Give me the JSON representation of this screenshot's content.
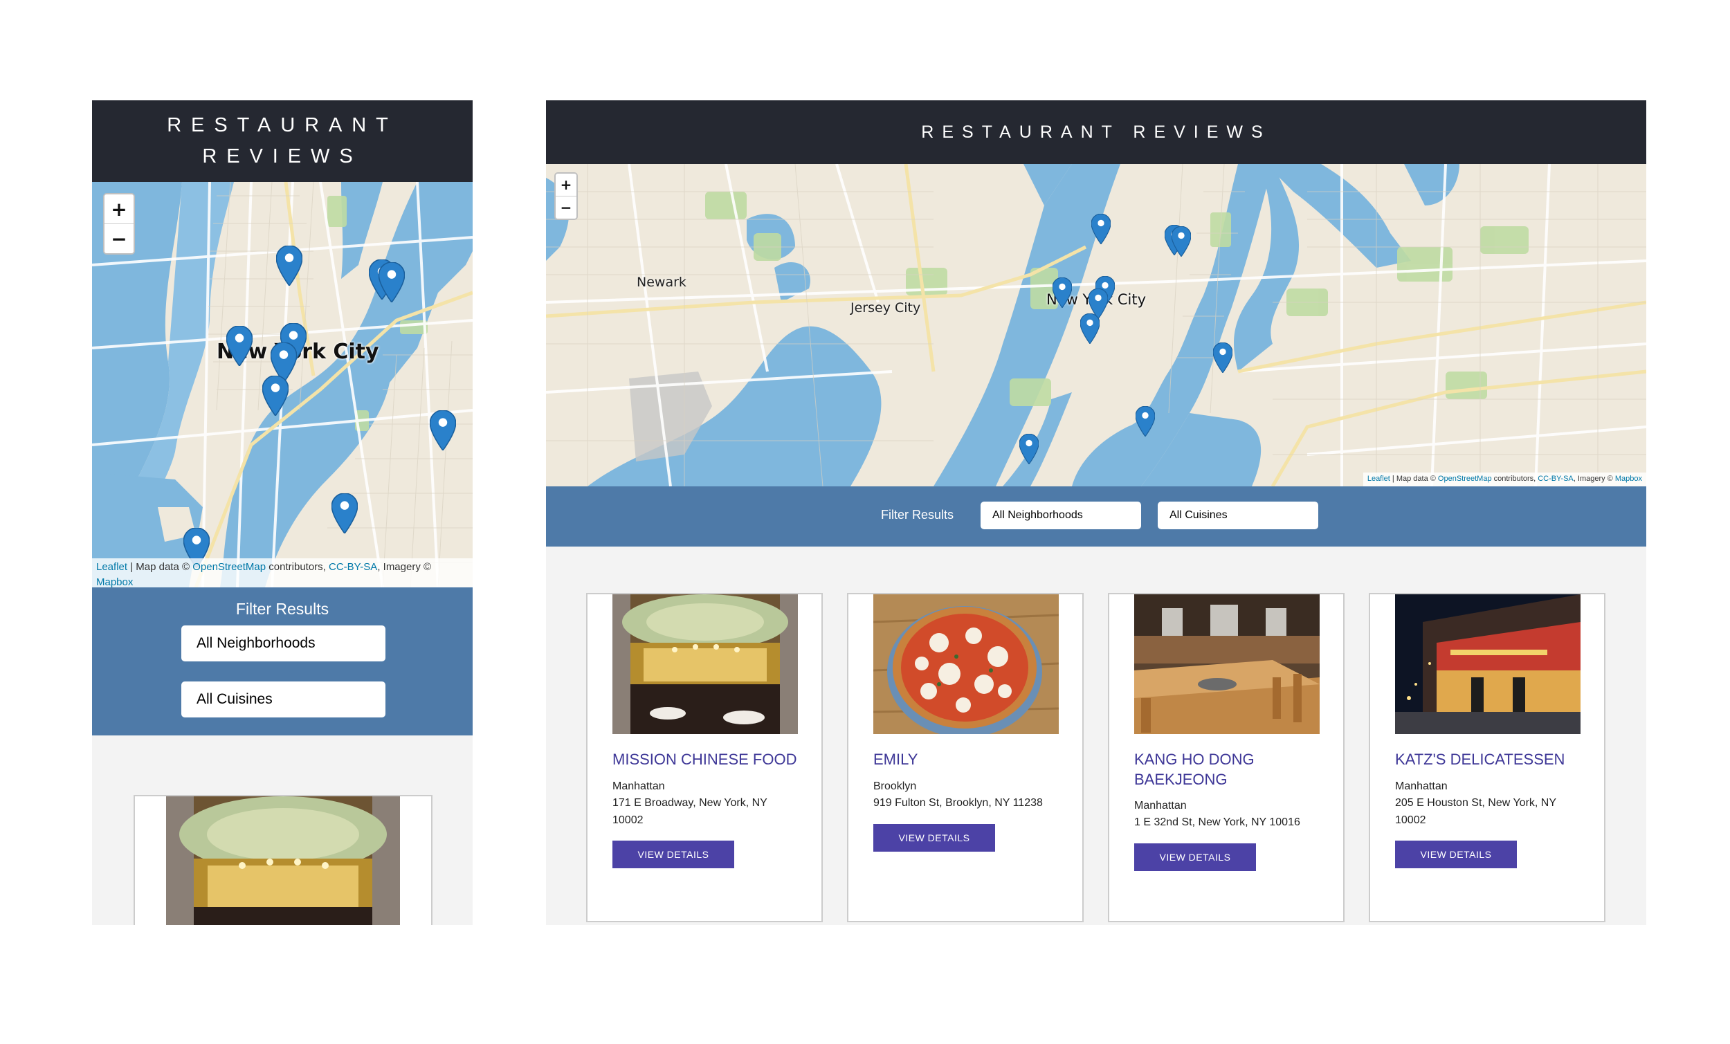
{
  "app": {
    "title": "RESTAURANT REVIEWS"
  },
  "map": {
    "zoom_in": "+",
    "zoom_out": "−",
    "city_label": "New York City",
    "labels": [
      "Newark",
      "Jersey City"
    ],
    "attribution": {
      "leaflet": "Leaflet",
      "map_data": " | Map data © ",
      "osm": "OpenStreetMap",
      "contributors": " contributors, ",
      "license": "CC-BY-SA",
      "imagery": ", Imagery © ",
      "provider": "Mapbox"
    },
    "marker_icon": "map-marker-icon",
    "colors": {
      "water": "#7fb7dd",
      "land": "#efe9dc",
      "park": "#bfdba3",
      "marker": "#2a81cb"
    }
  },
  "filter": {
    "label": "Filter Results",
    "neighborhood_value": "All Neighborhoods",
    "cuisine_value": "All Cuisines"
  },
  "restaurants": [
    {
      "name": "Mission Chinese Food",
      "neighborhood": "Manhattan",
      "address": "171 E Broadway, New York, NY 10002",
      "photo": "restaurant-interior-photo"
    },
    {
      "name": "Emily",
      "neighborhood": "Brooklyn",
      "address": "919 Fulton St, Brooklyn, NY 11238",
      "photo": "pizza-photo"
    },
    {
      "name": "Kang Ho Dong Baekjeong",
      "neighborhood": "Manhattan",
      "address": "1 E 32nd St, New York, NY 10016",
      "photo": "korean-bbq-interior-photo"
    },
    {
      "name": "Katz's Delicatessen",
      "neighborhood": "Manhattan",
      "address": "205 E Houston St, New York, NY 10002",
      "photo": "storefront-night-photo"
    }
  ],
  "card": {
    "button_label": "View Details"
  },
  "theme": {
    "header": "#252831",
    "filter_bar": "#4e7aa8",
    "accent": "#3e3797",
    "button": "#4c42a6"
  }
}
